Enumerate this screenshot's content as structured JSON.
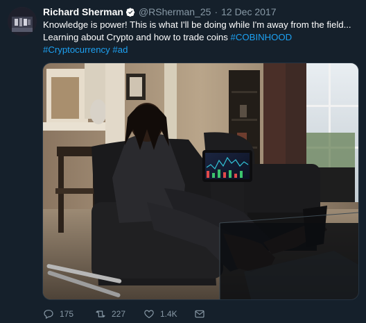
{
  "tweet": {
    "author_name": "Richard Sherman",
    "handle": "@RSherman_25",
    "separator": "·",
    "date": "12 Dec 2017",
    "text_line1": "Knowledge is power! This is what I'll be doing while I'm away from the field...",
    "text_line2_plain": "Learning about Crypto and how to trade coins ",
    "hashtag1": "#COBINHOOD",
    "hashtag2": "#Cryptocurrency",
    "hashtag3": "#ad"
  },
  "actions": {
    "reply_count": "175",
    "retweet_count": "227",
    "like_count": "1.4K"
  },
  "icons": {
    "verified": "verified-badge-icon",
    "reply": "reply-icon",
    "retweet": "retweet-icon",
    "like": "heart-icon",
    "dm": "direct-message-icon"
  },
  "colors": {
    "background": "#15202b",
    "link": "#1da1f2",
    "muted": "#8899a6"
  }
}
